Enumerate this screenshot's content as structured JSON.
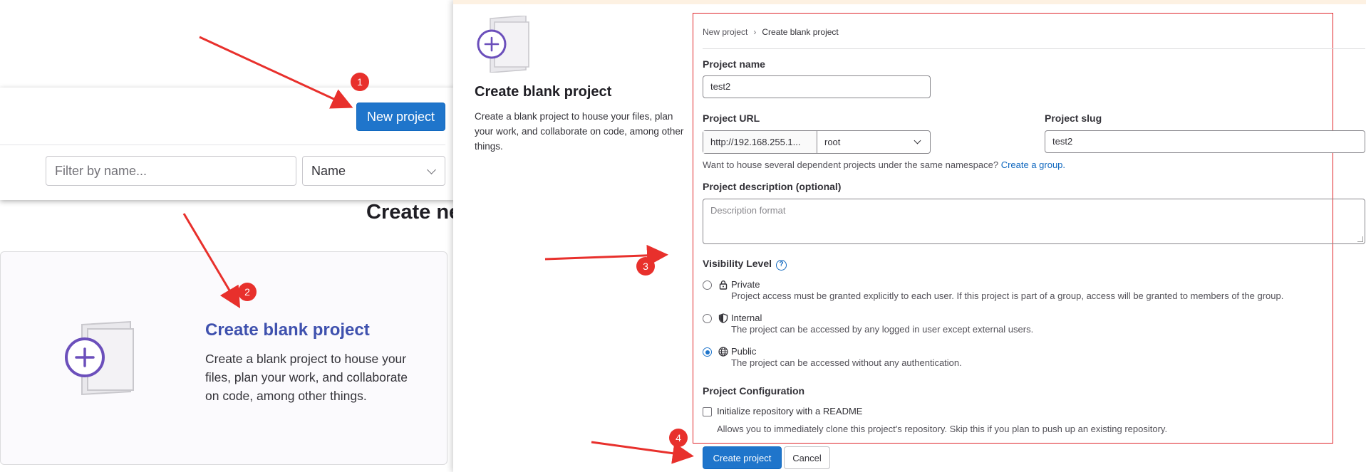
{
  "left": {
    "new_project_label": "New project",
    "filter_placeholder": "Filter by name...",
    "sort_value": "Name",
    "heading_partial": "Create ne",
    "card": {
      "title": "Create blank project",
      "description": "Create a blank project to house your files, plan your work, and collaborate on code, among other things."
    }
  },
  "panel": {
    "side_title": "Create blank project",
    "side_description": "Create a blank project to house your files, plan your work, and collaborate on code, among other things.",
    "breadcrumb": {
      "parent": "New project",
      "separator": "›",
      "current": "Create blank project"
    },
    "project_name": {
      "label": "Project name",
      "value": "test2"
    },
    "project_url": {
      "label": "Project URL",
      "prefix": "http://192.168.255.1...",
      "namespace": "root"
    },
    "project_slug": {
      "label": "Project slug",
      "value": "test2"
    },
    "namespace_help": {
      "text": "Want to house several dependent projects under the same namespace?",
      "link": "Create a group."
    },
    "description": {
      "label": "Project description (optional)",
      "placeholder": "Description format"
    },
    "visibility": {
      "label": "Visibility Level",
      "help_icon": "question-circle-icon",
      "options": [
        {
          "title": "Private",
          "icon": "lock-icon",
          "desc": "Project access must be granted explicitly to each user. If this project is part of a group, access will be granted to members of the group.",
          "checked": false
        },
        {
          "title": "Internal",
          "icon": "shield-icon",
          "desc": "The project can be accessed by any logged in user except external users.",
          "checked": false
        },
        {
          "title": "Public",
          "icon": "globe-icon",
          "desc": "The project can be accessed without any authentication.",
          "checked": true
        }
      ]
    },
    "config": {
      "label": "Project Configuration",
      "readme_label": "Initialize repository with a README",
      "readme_help": "Allows you to immediately clone this project's repository. Skip this if you plan to push up an existing repository.",
      "readme_checked": false
    },
    "create_label": "Create project",
    "cancel_label": "Cancel"
  },
  "annotations": {
    "badges": [
      "1",
      "2",
      "3",
      "4"
    ],
    "color": "#e8302c"
  },
  "colors": {
    "primary": "#1f75cb",
    "card_title": "#3f51ae",
    "annotation": "#e8302c",
    "link": "#1068bf"
  }
}
